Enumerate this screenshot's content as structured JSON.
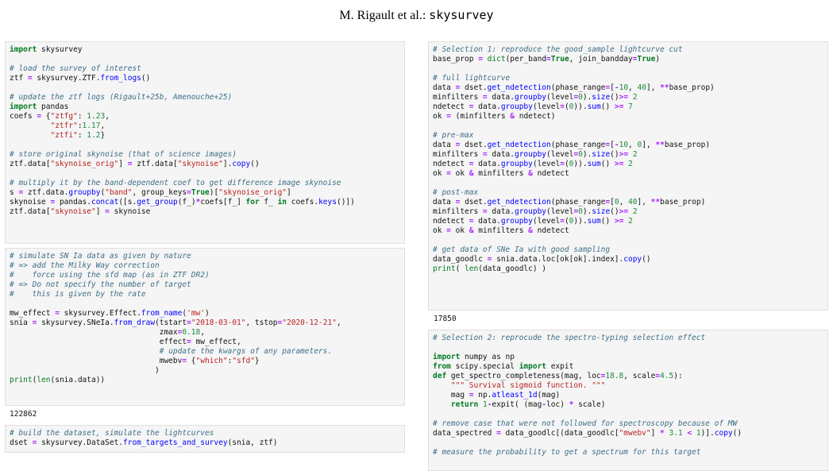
{
  "header": {
    "authors": "M. Rigault et al.:",
    "package": "skysurvey"
  },
  "left_column": {
    "cell1": [
      "import skysurvey",
      "",
      "# load the survey of interest",
      "ztf = skysurvey.ZTF.from_logs()",
      "",
      "# update the ztf logs (Rigault+25b, Amenouche+25)",
      "import pandas",
      "coefs = {\"ztfg\": 1.23,",
      "         \"ztfr\":1.17,",
      "         \"ztfi\": 1.2}",
      "",
      "# store original skynoise (that of science images)",
      "ztf.data[\"skynoise_orig\"] = ztf.data[\"skynoise\"].copy()",
      "",
      "# multiply it by the band-dependent coef to get difference image skynoise",
      "s = ztf.data.groupby(\"band\", group_keys=True)[\"skynoise_orig\"]",
      "skynoise = pandas.concat([s.get_group(f_)*coefs[f_] for f_ in coefs.keys()])",
      "ztf.data[\"skynoise\"] = skynoise"
    ],
    "cell2": [
      "# simulate SN Ia data as given by nature",
      "# => add the Milky Way correction",
      "#    force using the sfd map (as in ZTF DR2)",
      "# => Do not specify the number of target",
      "#    this is given by the rate",
      "",
      "mw_effect = skysurvey.Effect.from_name('mw')",
      "snia = skysurvey.SNeIa.from_draw(tstart=\"2018-03-01\", tstop=\"2020-12-21\",",
      "                                 zmax=0.18,",
      "                                 effect= mw_effect,",
      "                                 # update the kwargs of any parameters.",
      "                                 mwebv= {\"which\":\"sfd\"}",
      "                                )",
      "print(len(snia.data))"
    ],
    "output2": "122862",
    "cell3": [
      "# build the dataset, simulate the lightcurves",
      "dset = skysurvey.DataSet.from_targets_and_survey(snia, ztf)"
    ]
  },
  "right_column": {
    "cell1": [
      "# Selection 1: reproduce the good_sample lightcurve cut",
      "base_prop = dict(per_band=True, join_bandday=True)",
      "",
      "# full lightcurve",
      "data = dset.get_ndetection(phase_range=[-10, 40], **base_prop)",
      "minfilters = data.groupby(level=0).size()>= 2",
      "ndetect = data.groupby(level=(0)).sum() >= 7",
      "ok = (minfilters & ndetect)",
      "",
      "# pre-max",
      "data = dset.get_ndetection(phase_range=[-10, 0], **base_prop)",
      "minfilters = data.groupby(level=0).size()>= 2",
      "ndetect = data.groupby(level=(0)).sum() >= 2",
      "ok = ok & minfilters & ndetect",
      "",
      "# post-max",
      "data = dset.get_ndetection(phase_range=[0, 40], **base_prop)",
      "minfilters = data.groupby(level=0).size()>= 2",
      "ndetect = data.groupby(level=(0)).sum() >= 2",
      "ok = ok & minfilters & ndetect",
      "",
      "# get data of SNe Ia with good sampling",
      "data_goodlc = snia.data.loc[ok[ok].index].copy()",
      "print( len(data_goodlc) )"
    ],
    "output1": "17850",
    "cell2": [
      "# Selection 2: reprocude the spectro-typing selection effect",
      "",
      "import numpy as np",
      "from scipy.special import expit",
      "def get_spectro_completeness(mag, loc=18.8, scale=4.5):",
      "    \"\"\" Survival sigmoid function. \"\"\"",
      "    mag = np.atleast_1d(mag)",
      "    return 1-expit( (mag-loc) * scale)",
      "",
      "# remove case that were not followed for spectroscopy because of MW",
      "data_spectred = data_goodlc[(data_goodlc[\"mwebv\"] * 3.1 < 1)].copy()",
      "",
      "# measure the probability to get a spectrum for this target"
    ]
  }
}
